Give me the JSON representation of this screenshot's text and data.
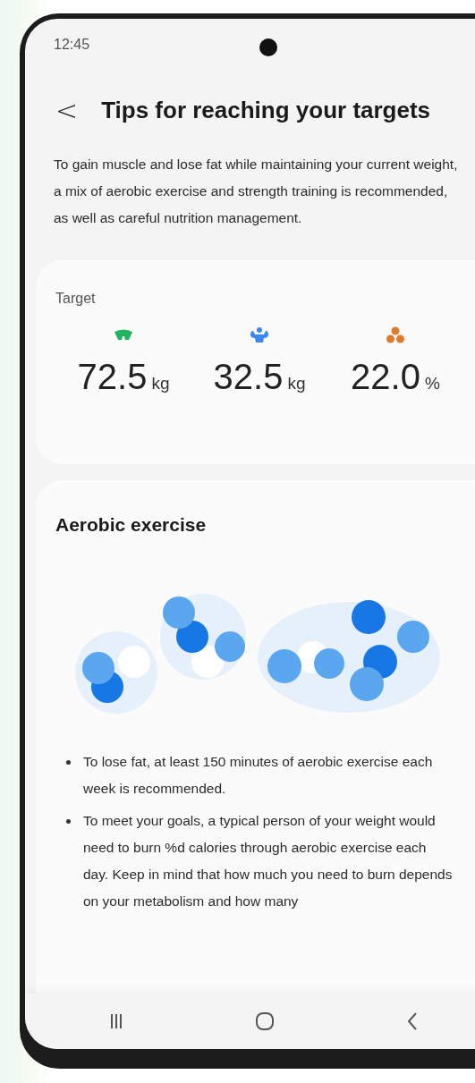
{
  "status_bar": {
    "time": "12:45"
  },
  "header": {
    "back": "<",
    "title": "Tips for reaching your targets"
  },
  "intro": "To gain muscle and lose fat while maintaining your current weight, a mix of aerobic exercise and strength training is recommended, as well as careful nutrition management.",
  "target_card": {
    "label": "Target",
    "metrics": [
      {
        "kind": "weight",
        "color": "#22b35e",
        "value": "72.5",
        "unit": "kg"
      },
      {
        "kind": "muscle",
        "color": "#3d87f0",
        "value": "32.5",
        "unit": "kg"
      },
      {
        "kind": "fat",
        "color": "#e07b2c",
        "value": "22.0",
        "unit": "%"
      }
    ]
  },
  "aerobic_card": {
    "title": "Aerobic exercise",
    "bullets": [
      "To lose fat, at least 150 minutes of aerobic exercise each week is recommended.",
      "To meet your goals, a typical person of your weight would need to burn %d calories through aerobic exercise each day. Keep in mind that how much you need to burn depends on your metabolism and how many"
    ]
  }
}
